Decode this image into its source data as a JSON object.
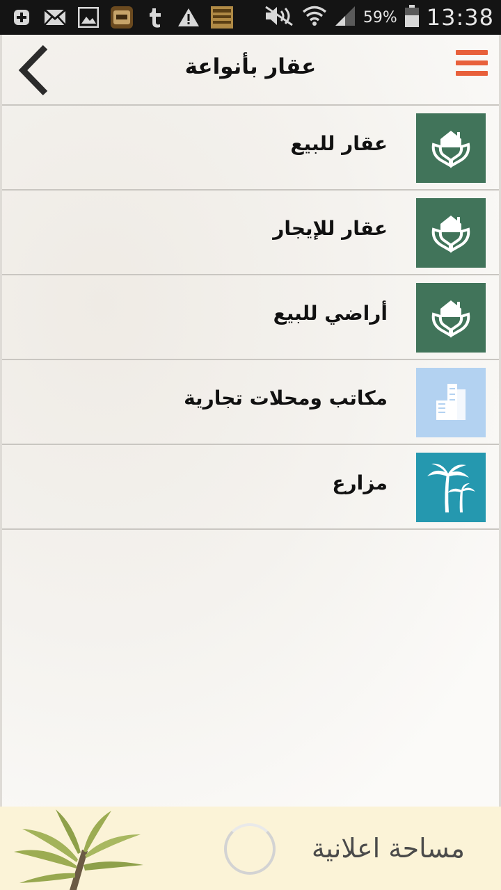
{
  "status_bar": {
    "battery": "59%",
    "time": "13:38",
    "icons": [
      "plus-box-icon",
      "mail-icon",
      "image-icon",
      "app-badge-icon",
      "tumblr-icon",
      "warning-icon",
      "app-badge-2-icon",
      "mute-icon",
      "wifi-icon",
      "signal-icon",
      "battery-icon"
    ]
  },
  "header": {
    "title": "عقار بأنواعة",
    "back_icon": "chevron-left-icon",
    "menu_icon": "hamburger-icon",
    "accent_color": "#e8603b"
  },
  "categories": [
    {
      "label": "عقار للبيع",
      "icon": "hands-house-icon",
      "color": "#41745a"
    },
    {
      "label": "عقار للإيجار",
      "icon": "hands-house-icon",
      "color": "#41745a"
    },
    {
      "label": "أراضي للبيع",
      "icon": "hands-house-icon",
      "color": "#41745a"
    },
    {
      "label": "مكاتب ومحلات تجارية",
      "icon": "building-icon",
      "color": "#b3d2f1"
    },
    {
      "label": "مزارع",
      "icon": "palm-trees-icon",
      "color": "#2598af"
    }
  ],
  "ad": {
    "text": "مساحة اعلانية",
    "background": "#fbf3d7"
  }
}
